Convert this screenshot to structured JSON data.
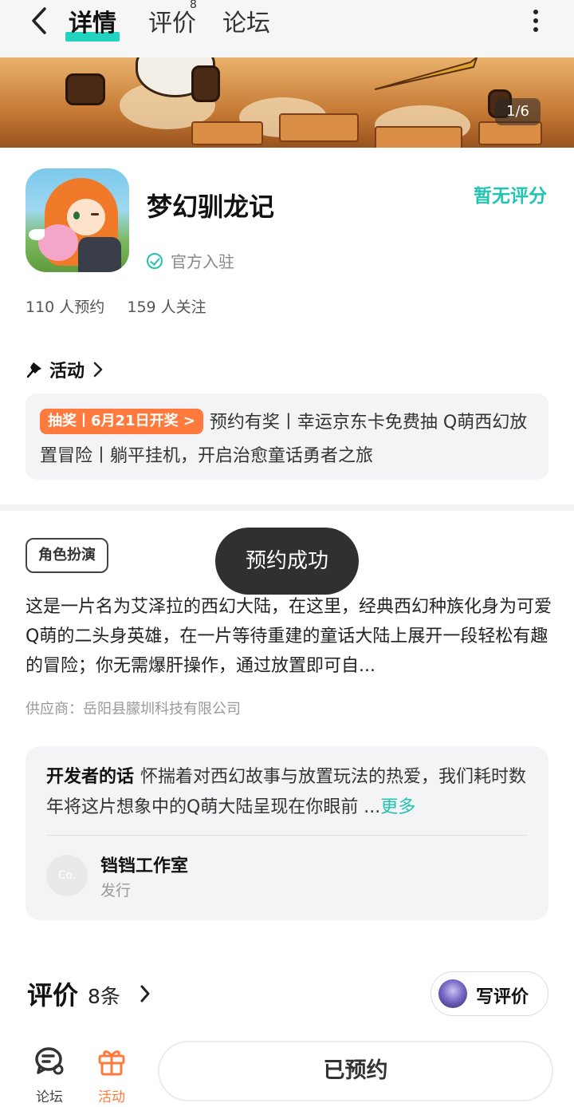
{
  "nav": {
    "tabs": [
      {
        "label": "详情",
        "active": true
      },
      {
        "label": "评价",
        "badge": "8"
      },
      {
        "label": "论坛"
      }
    ]
  },
  "banner": {
    "counter": "1/6"
  },
  "app": {
    "name": "梦幻驯龙记",
    "official": "官方入驻",
    "rating": "暂无评分",
    "reservations": "110 人预约",
    "followers": "159 人关注"
  },
  "activity": {
    "heading": "活动",
    "badge": "抽奖丨6月21日开奖 >",
    "text": "预约有奖丨幸运京东卡免费抽 Q萌西幻放置冒险丨躺平挂机，开启治愈童话勇者之旅"
  },
  "description": {
    "tag": "角色扮演",
    "text": "这是一片名为艾泽拉的西幻大陆，在这里，经典西幻种族化身为可爱Q萌的二头身英雄，在一片等待重建的童话大陆上展开一段轻松有趣的冒险；你无需爆肝操作，通过放置即可自...",
    "supplier": "供应商：岳阳县朦圳科技有限公司"
  },
  "toast": "预约成功",
  "developer": {
    "label": "开发者的话",
    "words": "怀揣着对西幻故事与放置玩法的热爱，我们耗时数年将这片想象中的Q萌大陆呈现在你眼前 ...",
    "more": "更多",
    "avatar_text": "Co.",
    "name": "铛铛工作室",
    "role": "发行"
  },
  "reviews": {
    "title": "评价",
    "count": "8条",
    "write": "写评价"
  },
  "bottom": {
    "forum": "论坛",
    "activity": "活动",
    "reserved": "已预约"
  },
  "colors": {
    "accent": "#21c3b1",
    "orange": "#ff7a3c",
    "toast_bg": "#303030"
  }
}
